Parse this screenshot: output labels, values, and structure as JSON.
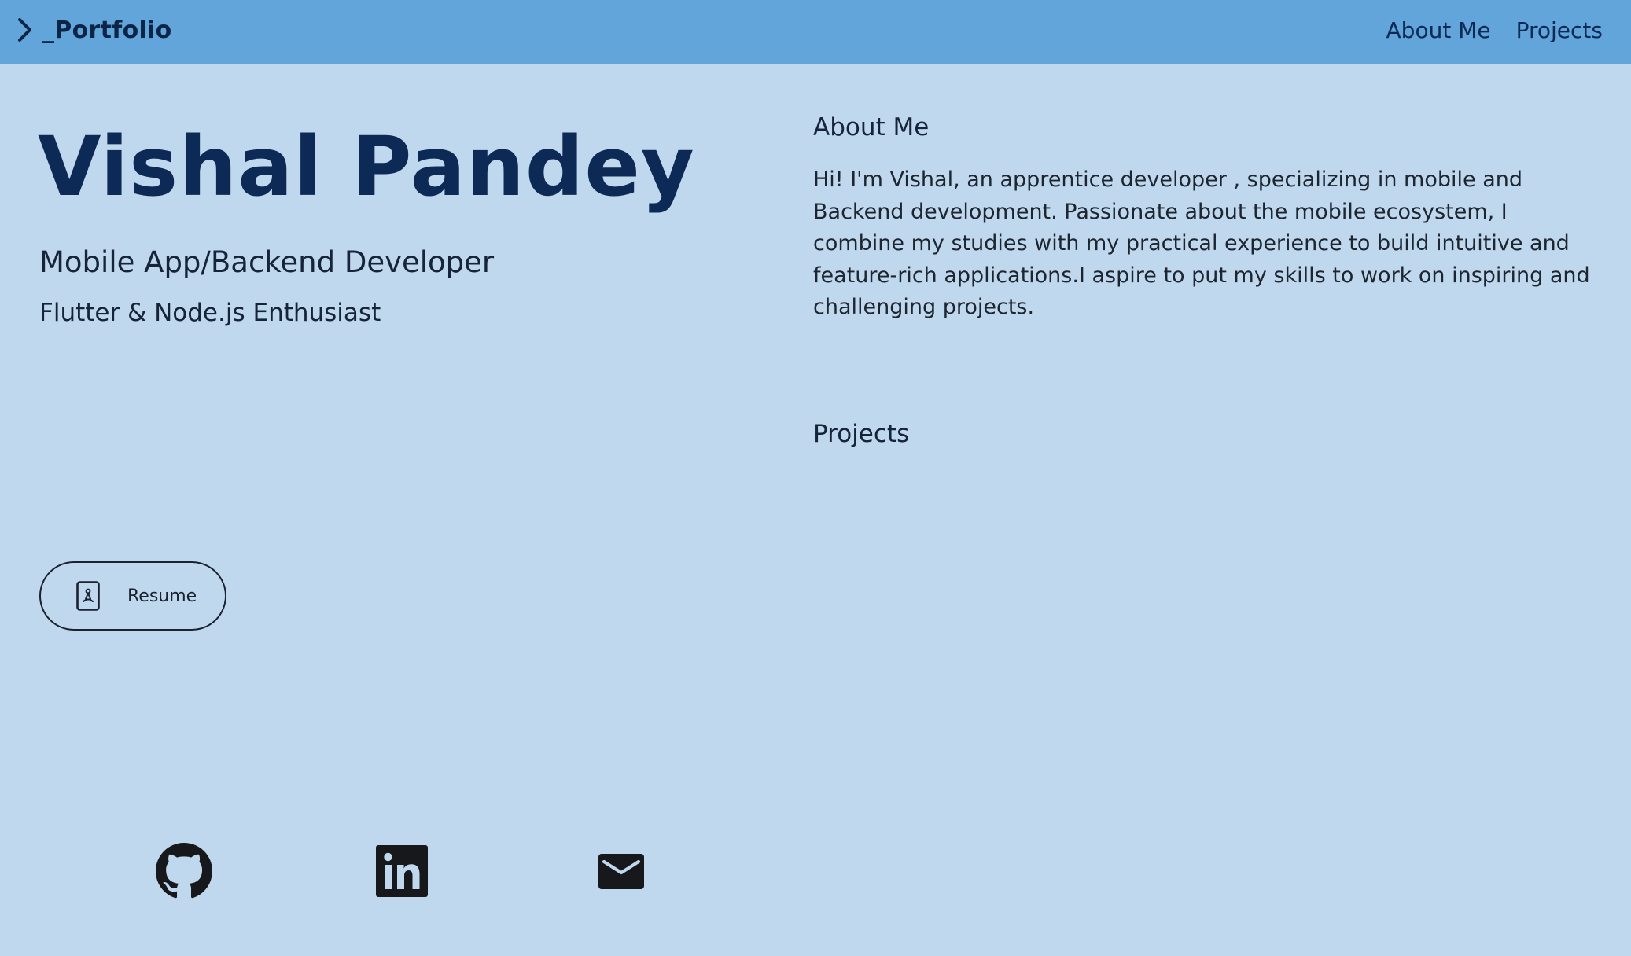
{
  "nav": {
    "brand": "_Portfolio",
    "links": [
      "About Me",
      "Projects"
    ]
  },
  "hero": {
    "name": "Vishal Pandey",
    "role": "Mobile App/Backend Developer",
    "tagline": "Flutter & Node.js Enthusiast"
  },
  "resume": {
    "label": "Resume",
    "icon": "pdf-file-icon"
  },
  "socials": [
    {
      "icon": "github-icon"
    },
    {
      "icon": "linkedin-icon"
    },
    {
      "icon": "mail-icon"
    }
  ],
  "about": {
    "title": "About Me",
    "text": "Hi! I'm Vishal, an apprentice developer , specializing in mobile and Backend development. Passionate about the mobile ecosystem, I combine my studies with my practical experience to build intuitive and feature-rich applications.I aspire to put my skills to work on inspiring and challenging projects."
  },
  "projects": {
    "title": "Projects"
  },
  "colors": {
    "navbar": "#62a5da",
    "background": "#c0d8ee",
    "heading": "#0c2a55",
    "text": "#1c2530"
  }
}
